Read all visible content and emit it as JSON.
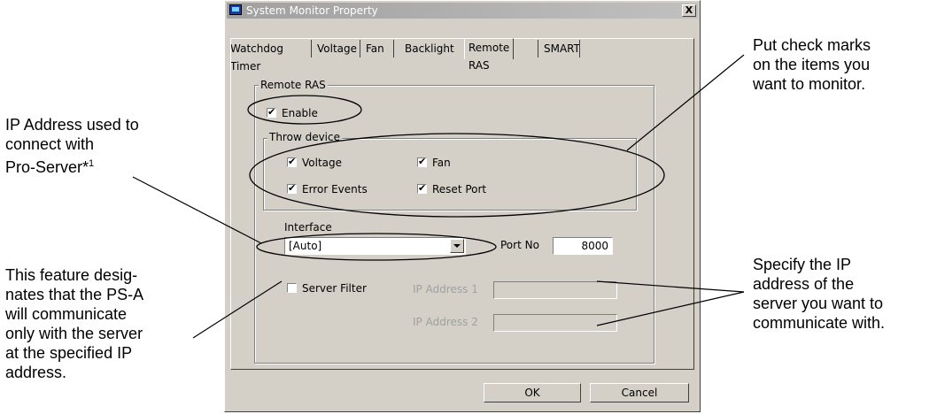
{
  "window": {
    "title": "System Monitor Property",
    "close_label": "X"
  },
  "tabs": [
    {
      "label": "Watchdog Timer"
    },
    {
      "label": "Voltage"
    },
    {
      "label": "Fan"
    },
    {
      "label": "Backlight"
    },
    {
      "label": "Remote RAS",
      "selected": true
    },
    {
      "label": "SMART"
    }
  ],
  "remote_ras": {
    "group_label": "Remote RAS",
    "enable": {
      "label": "Enable",
      "checked": true
    },
    "throw_device": {
      "group_label": "Throw device",
      "items": [
        {
          "label": "Voltage",
          "checked": true
        },
        {
          "label": "Fan",
          "checked": true
        },
        {
          "label": "Error Events",
          "checked": true
        },
        {
          "label": "Reset Port",
          "checked": true
        }
      ]
    },
    "interface": {
      "label": "Interface",
      "value": "[Auto]"
    },
    "port": {
      "label": "Port No",
      "value": "8000"
    },
    "server_filter": {
      "label": "Server Filter",
      "checked": false
    },
    "ip1": {
      "label": "IP Address 1",
      "value": ""
    },
    "ip2": {
      "label": "IP Address 2",
      "value": ""
    }
  },
  "buttons": {
    "ok": "OK",
    "cancel": "Cancel"
  },
  "callouts": {
    "ip_address": "IP Address used to\nconnect with\nPro-Server*",
    "ip_address_sup": "1",
    "server_filter": "This feature desig-\nnates that the PS-A\nwill communicate\nonly with the server\nat the specified IP\naddress.",
    "check_marks": "Put check marks\non the items you\nwant to monitor.",
    "specify_ip": "Specify the IP\naddress of the\nserver you want to\ncommunicate with."
  }
}
